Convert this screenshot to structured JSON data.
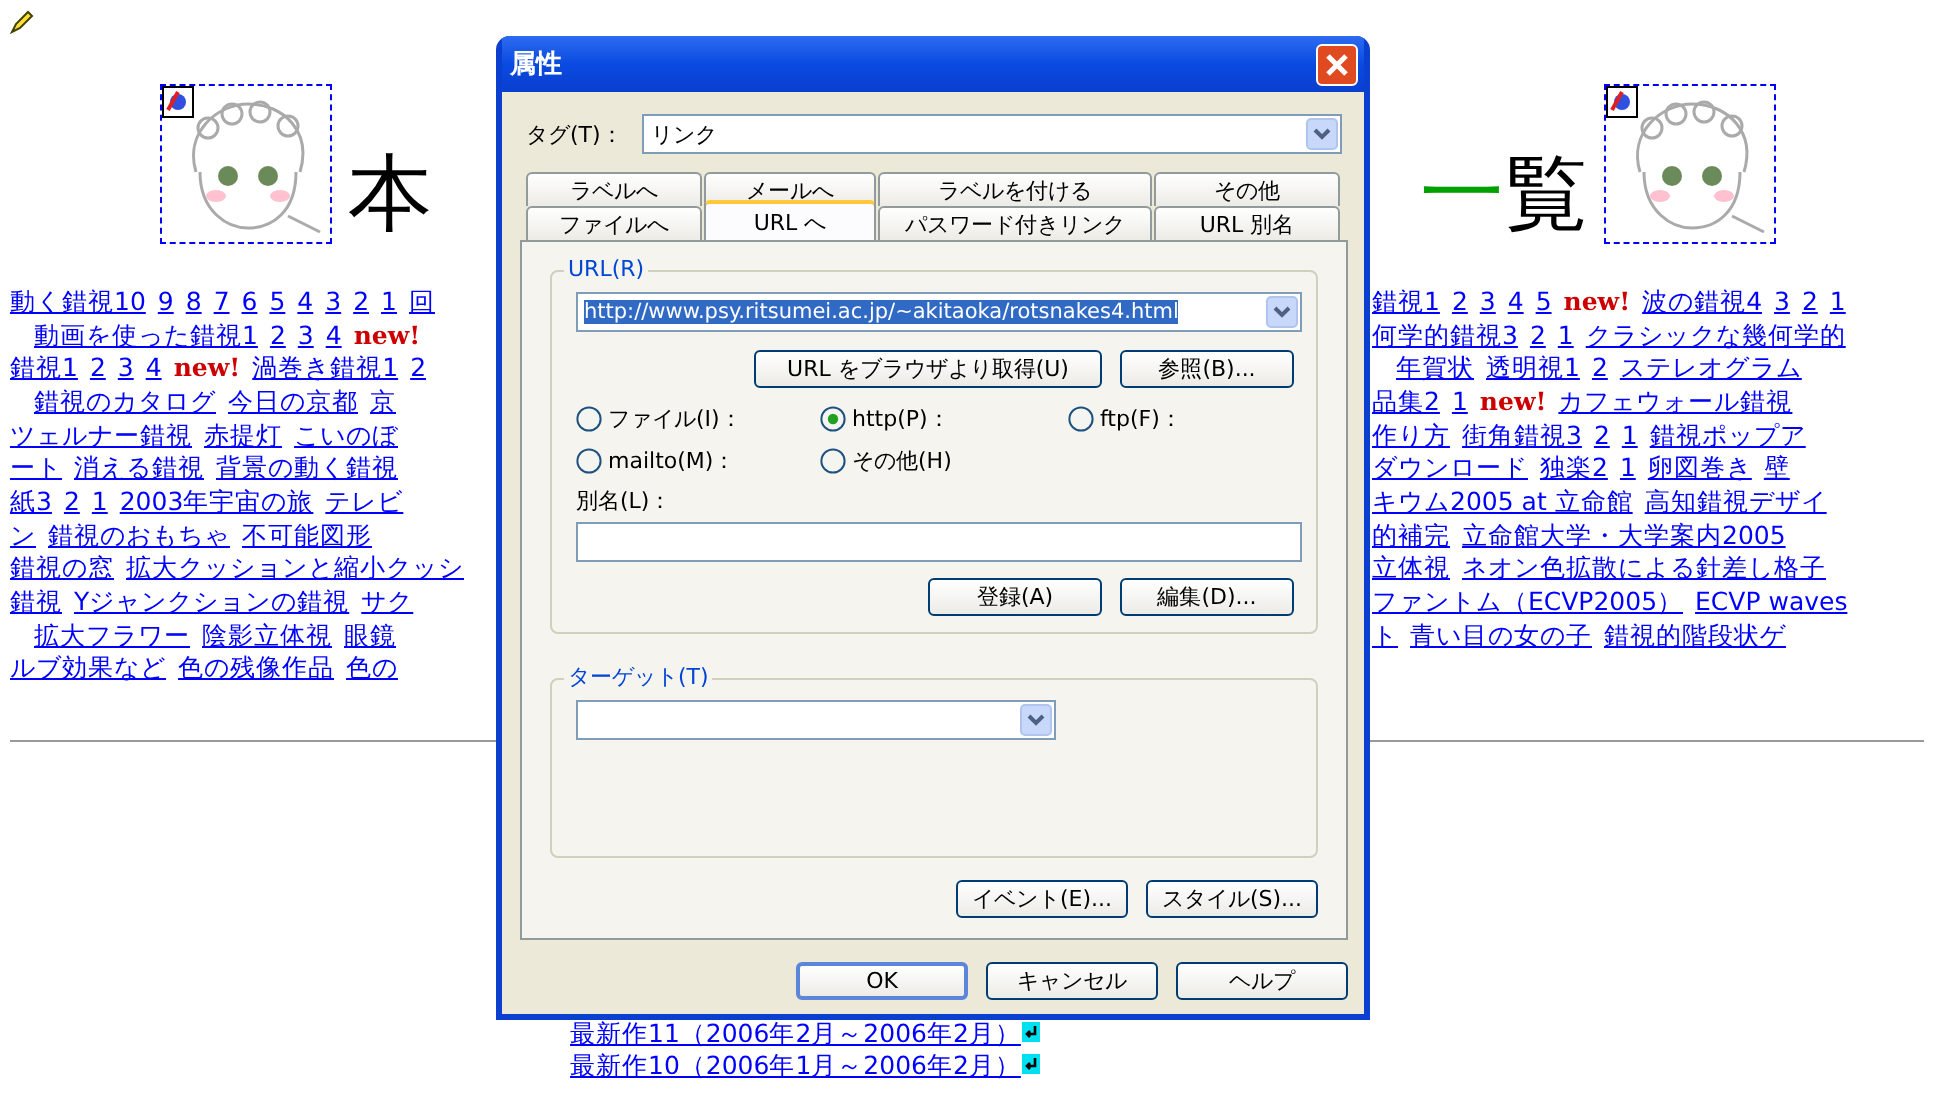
{
  "page": {
    "header": {
      "title_left": [
        {
          "text": "本",
          "color": "#000000"
        }
      ],
      "title_right": [
        {
          "text": "一",
          "color": "#00a000"
        },
        {
          "text": "覧",
          "color": "#000000"
        }
      ]
    },
    "left_lines": [
      {
        "indented": false,
        "items": [
          {
            "kind": "link",
            "text": "動く錯視10"
          },
          {
            "kind": "link",
            "text": "9"
          },
          {
            "kind": "link",
            "text": "8"
          },
          {
            "kind": "link",
            "text": "7"
          },
          {
            "kind": "link",
            "text": "6"
          },
          {
            "kind": "link",
            "text": "5"
          },
          {
            "kind": "link",
            "text": "4"
          },
          {
            "kind": "link",
            "text": "3"
          },
          {
            "kind": "link",
            "text": "2"
          },
          {
            "kind": "link",
            "text": "1"
          },
          {
            "kind": "link",
            "text": "回"
          }
        ]
      },
      {
        "indented": true,
        "items": [
          {
            "kind": "link",
            "text": "動画を使った錯視1"
          },
          {
            "kind": "link",
            "text": "2"
          },
          {
            "kind": "link",
            "text": "3"
          },
          {
            "kind": "link",
            "text": "4"
          },
          {
            "kind": "new",
            "text": "new!"
          }
        ]
      },
      {
        "indented": false,
        "items": [
          {
            "kind": "link",
            "text": "錯視1"
          },
          {
            "kind": "link",
            "text": "2"
          },
          {
            "kind": "link",
            "text": "3"
          },
          {
            "kind": "link",
            "text": "4"
          },
          {
            "kind": "new",
            "text": "new!"
          },
          {
            "kind": "link",
            "text": "渦巻き錯視1"
          },
          {
            "kind": "link",
            "text": "2"
          }
        ]
      },
      {
        "indented": true,
        "items": [
          {
            "kind": "link",
            "text": "錯視のカタログ"
          },
          {
            "kind": "link",
            "text": "今日の京都"
          },
          {
            "kind": "link",
            "text": "京"
          }
        ]
      },
      {
        "indented": false,
        "items": [
          {
            "kind": "link",
            "text": "ツェルナー錯視"
          },
          {
            "kind": "link",
            "text": "赤提灯"
          },
          {
            "kind": "link",
            "text": "こいのぼ"
          }
        ]
      },
      {
        "indented": false,
        "items": [
          {
            "kind": "link",
            "text": "ート"
          },
          {
            "kind": "link",
            "text": "消える錯視"
          },
          {
            "kind": "link",
            "text": "背景の動く錯視"
          }
        ]
      },
      {
        "indented": false,
        "items": [
          {
            "kind": "link",
            "text": "紙3"
          },
          {
            "kind": "link",
            "text": "2"
          },
          {
            "kind": "link",
            "text": "1"
          },
          {
            "kind": "link",
            "text": "2003年宇宙の旅"
          },
          {
            "kind": "link",
            "text": "テレビ"
          }
        ]
      },
      {
        "indented": false,
        "items": [
          {
            "kind": "link",
            "text": "ン"
          },
          {
            "kind": "link",
            "text": "錯視のおもちゃ"
          },
          {
            "kind": "link",
            "text": "不可能図形"
          }
        ]
      },
      {
        "indented": false,
        "items": [
          {
            "kind": "link",
            "text": "錯視の窓"
          },
          {
            "kind": "link",
            "text": "拡大クッションと縮小クッシ"
          }
        ]
      },
      {
        "indented": false,
        "items": [
          {
            "kind": "link",
            "text": "錯視"
          },
          {
            "kind": "link",
            "text": "Yジャンクションの錯視"
          },
          {
            "kind": "link",
            "text": "サク"
          }
        ]
      },
      {
        "indented": true,
        "items": [
          {
            "kind": "link",
            "text": "拡大フラワー"
          },
          {
            "kind": "link",
            "text": "陰影立体視"
          },
          {
            "kind": "link",
            "text": "眼鏡"
          }
        ]
      },
      {
        "indented": false,
        "items": [
          {
            "kind": "link",
            "text": "ルブ効果など"
          },
          {
            "kind": "link",
            "text": "色の残像作品"
          },
          {
            "kind": "link",
            "text": "色の"
          }
        ]
      }
    ],
    "right_lines": [
      {
        "indented": false,
        "items": [
          {
            "kind": "link",
            "text": "錯視1"
          },
          {
            "kind": "link",
            "text": "2"
          },
          {
            "kind": "link",
            "text": "3"
          },
          {
            "kind": "link",
            "text": "4"
          },
          {
            "kind": "link",
            "text": "5"
          },
          {
            "kind": "new",
            "text": "new!"
          },
          {
            "kind": "link",
            "text": "波の錯視4"
          },
          {
            "kind": "link",
            "text": "3"
          },
          {
            "kind": "link",
            "text": "2"
          },
          {
            "kind": "link",
            "text": "1"
          }
        ]
      },
      {
        "indented": false,
        "items": [
          {
            "kind": "link",
            "text": "何学的錯視3"
          },
          {
            "kind": "link",
            "text": "2"
          },
          {
            "kind": "link",
            "text": "1"
          },
          {
            "kind": "link",
            "text": "クラシックな幾何学的"
          }
        ]
      },
      {
        "indented": true,
        "items": [
          {
            "kind": "link",
            "text": "年賀状"
          },
          {
            "kind": "link",
            "text": "透明視1"
          },
          {
            "kind": "link",
            "text": "2"
          },
          {
            "kind": "link",
            "text": "ステレオグラム"
          }
        ]
      },
      {
        "indented": false,
        "items": [
          {
            "kind": "link",
            "text": "品集2"
          },
          {
            "kind": "link",
            "text": "1"
          },
          {
            "kind": "new",
            "text": "new!"
          },
          {
            "kind": "link",
            "text": "カフェウォール錯視"
          }
        ]
      },
      {
        "indented": false,
        "items": [
          {
            "kind": "link",
            "text": "作り方"
          },
          {
            "kind": "link",
            "text": "街角錯視3"
          },
          {
            "kind": "link",
            "text": "2"
          },
          {
            "kind": "link",
            "text": "1"
          },
          {
            "kind": "link",
            "text": "錯視ポップア"
          }
        ]
      },
      {
        "indented": false,
        "items": [
          {
            "kind": "link",
            "text": "ダウンロード"
          },
          {
            "kind": "link",
            "text": "独楽2"
          },
          {
            "kind": "link",
            "text": "1"
          },
          {
            "kind": "link",
            "text": "卵図巻き"
          },
          {
            "kind": "link",
            "text": "壁"
          }
        ]
      },
      {
        "indented": false,
        "items": [
          {
            "kind": "link",
            "text": "キウム2005 at 立命館"
          },
          {
            "kind": "link",
            "text": "高知錯視デザイ"
          }
        ]
      },
      {
        "indented": false,
        "items": [
          {
            "kind": "link",
            "text": "的補完"
          },
          {
            "kind": "link",
            "text": "立命館大学・大学案内2005"
          }
        ]
      },
      {
        "indented": false,
        "items": [
          {
            "kind": "link",
            "text": "立体視"
          },
          {
            "kind": "link",
            "text": "ネオン色拡散による針差し格子"
          }
        ]
      },
      {
        "indented": false,
        "items": [
          {
            "kind": "link",
            "text": "ファントム（ECVP2005）"
          },
          {
            "kind": "link",
            "text": "ECVP waves"
          }
        ]
      },
      {
        "indented": false,
        "items": [
          {
            "kind": "link",
            "text": "ト"
          },
          {
            "kind": "link",
            "text": "青い目の女の子"
          },
          {
            "kind": "link",
            "text": "錯視的階段状ゲ"
          }
        ]
      }
    ],
    "recent_links": [
      "最新作11（2006年2月～2006年2月）",
      "最新作10（2006年1月～2006年2月）"
    ]
  },
  "dialog": {
    "title": "属性",
    "tag_label": "タグ(T)：",
    "tag_value": "リンク",
    "tab_rows": [
      [
        {
          "label": "ラベルへ",
          "selected": false
        },
        {
          "label": "メールへ",
          "selected": false
        },
        {
          "label": "ラベルを付ける",
          "selected": false
        },
        {
          "label": "その他",
          "selected": false
        }
      ],
      [
        {
          "label": "ファイルへ",
          "selected": false
        },
        {
          "label": "URL へ",
          "selected": true
        },
        {
          "label": "パスワード付きリンク",
          "selected": false
        },
        {
          "label": "URL 別名",
          "selected": false
        }
      ]
    ],
    "url_group": {
      "legend": "URL(R)",
      "url": "http://www.psy.ritsumei.ac.jp/~akitaoka/rotsnakes4.html",
      "buttons": [
        "URL をブラウザより取得(U)",
        "参照(B)..."
      ],
      "radios": [
        {
          "label": "ファイル(I)：",
          "selected": false
        },
        {
          "label": "http(P)：",
          "selected": true
        },
        {
          "label": "ftp(F)：",
          "selected": false
        },
        {
          "label": "mailto(M)：",
          "selected": false
        },
        {
          "label": "その他(H)",
          "selected": false
        }
      ],
      "alias_label": "別名(L)：",
      "alias_buttons": [
        "登録(A)",
        "編集(D)..."
      ]
    },
    "target_group": {
      "legend": "ターゲット(T)"
    },
    "panel_buttons": [
      "イベント(E)...",
      "スタイル(S)..."
    ],
    "footer_buttons": [
      {
        "label": "OK",
        "default": true
      },
      {
        "label": "キャンセル",
        "default": false
      },
      {
        "label": "ヘルプ",
        "default": false
      }
    ]
  }
}
